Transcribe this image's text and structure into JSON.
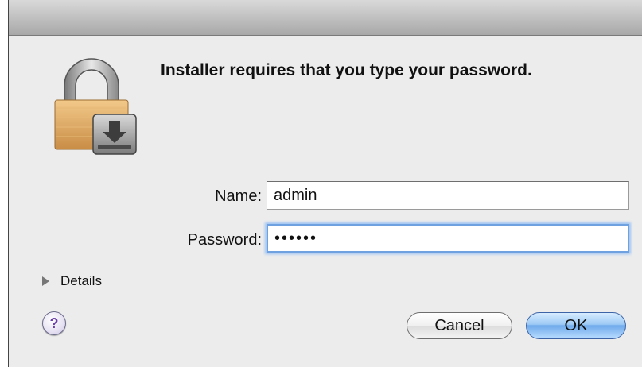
{
  "dialog": {
    "message": "Installer requires that you type your password.",
    "icon": "lock-installer-icon"
  },
  "form": {
    "name_label": "Name:",
    "name_value": "admin",
    "password_label": "Password:",
    "password_value": "••••••"
  },
  "details_label": "Details",
  "help_label": "?",
  "buttons": {
    "cancel": "Cancel",
    "ok": "OK"
  },
  "colors": {
    "accent": "#6ea9ea",
    "window_bg": "#ececec"
  }
}
